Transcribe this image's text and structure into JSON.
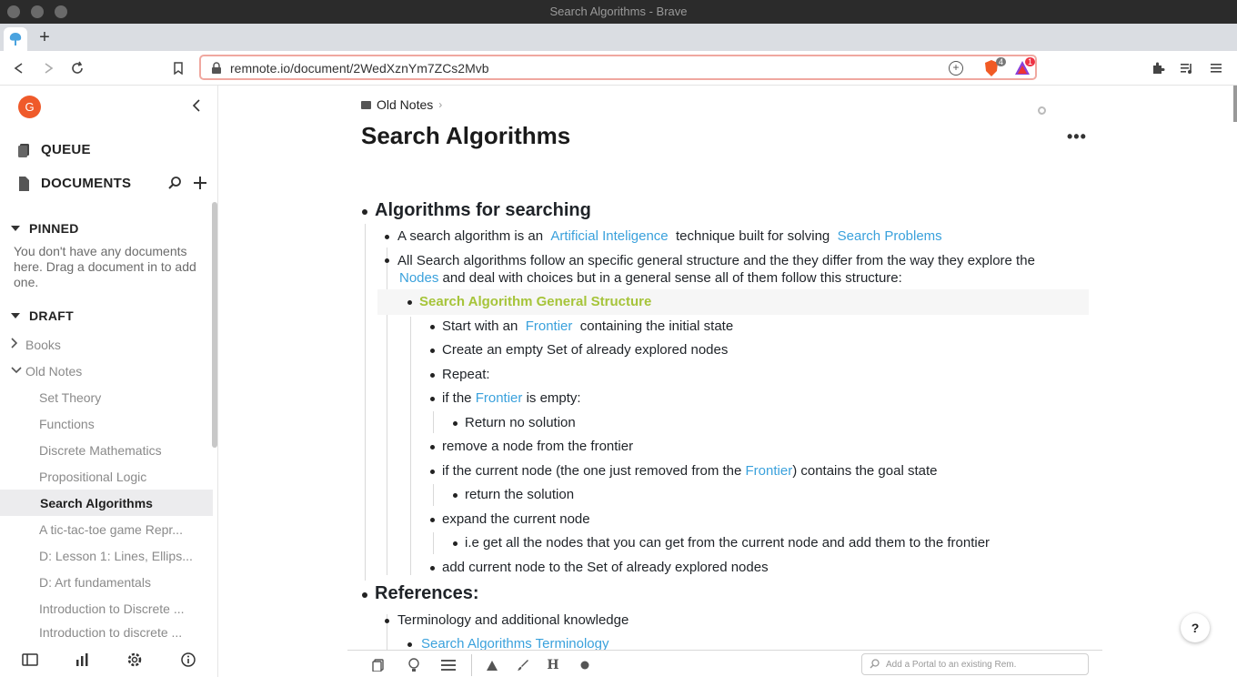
{
  "window": {
    "title": "Search Algorithms - Brave"
  },
  "browser": {
    "url": "remnote.io/document/2WedXznYm7ZCs2Mvb",
    "shield_count": "4",
    "rewards_count": "1"
  },
  "sidebar": {
    "avatar_letter": "G",
    "queue_label": "QUEUE",
    "documents_label": "DOCUMENTS",
    "pinned_label": "PINNED",
    "pinned_message": "You don't have any documents here. Drag a document in to add one.",
    "draft_label": "DRAFT",
    "tree": [
      {
        "label": "Books",
        "toggle": "›"
      },
      {
        "label": "Old Notes",
        "toggle": "⌄"
      },
      {
        "label": "Set Theory"
      },
      {
        "label": "Functions"
      },
      {
        "label": "Discrete Mathematics"
      },
      {
        "label": "Propositional Logic"
      },
      {
        "label": "Search Algorithms"
      },
      {
        "label": "A tic-tac-toe game Repr..."
      },
      {
        "label": "D: Lesson 1: Lines, Ellips..."
      },
      {
        "label": "D: Art fundamentals"
      },
      {
        "label": "Introduction to Discrete ..."
      },
      {
        "label": "Introduction to discrete ..."
      }
    ]
  },
  "document": {
    "breadcrumb": "Old Notes",
    "title": "Search Algorithms",
    "heading1": "Algorithms for searching",
    "l1_a": "A search algorithm is an",
    "l1_link1": "Artificial Inteligence",
    "l1_b": "technique built for solving",
    "l1_link2": "Search Problems",
    "l2_a": "All Search algorithms follow an specific general structure and the they differ from the way they explore the",
    "l2_link": "Nodes",
    "l2_b": "and deal with choices but in a general sense all of them follow this structure:",
    "structure_title": "Search Algorithm General Structure",
    "s1_a": "Start with an",
    "s1_link": "Frontier",
    "s1_b": "containing the initial state",
    "s2": "Create an empty Set  of already explored nodes",
    "s3": "Repeat:",
    "s4_a": "if the",
    "s4_link": "Frontier",
    "s4_b": "is empty:",
    "s4_child": "Return no solution",
    "s5": "remove a node from the frontier",
    "s6_a": "if the current node (the one just removed from the",
    "s6_link": "Frontier",
    "s6_b": ")  contains the goal state",
    "s6_child": "return the solution",
    "s7": "expand the current node",
    "s7_child": "i.e get all the nodes that you can get from the current node and add them to the frontier",
    "s8": "add current node to the Set  of already explored nodes",
    "heading2": "References:",
    "r1": "Terminology and additional knowledge",
    "r1_link": "Search Algorithms Terminology"
  },
  "bottom": {
    "portal_placeholder": "Add a Portal to an existing Rem.",
    "help": "?"
  },
  "colors": {
    "link": "#3aa1dc",
    "structure": "#a6c43a",
    "avatar": "#ef5a2a"
  }
}
